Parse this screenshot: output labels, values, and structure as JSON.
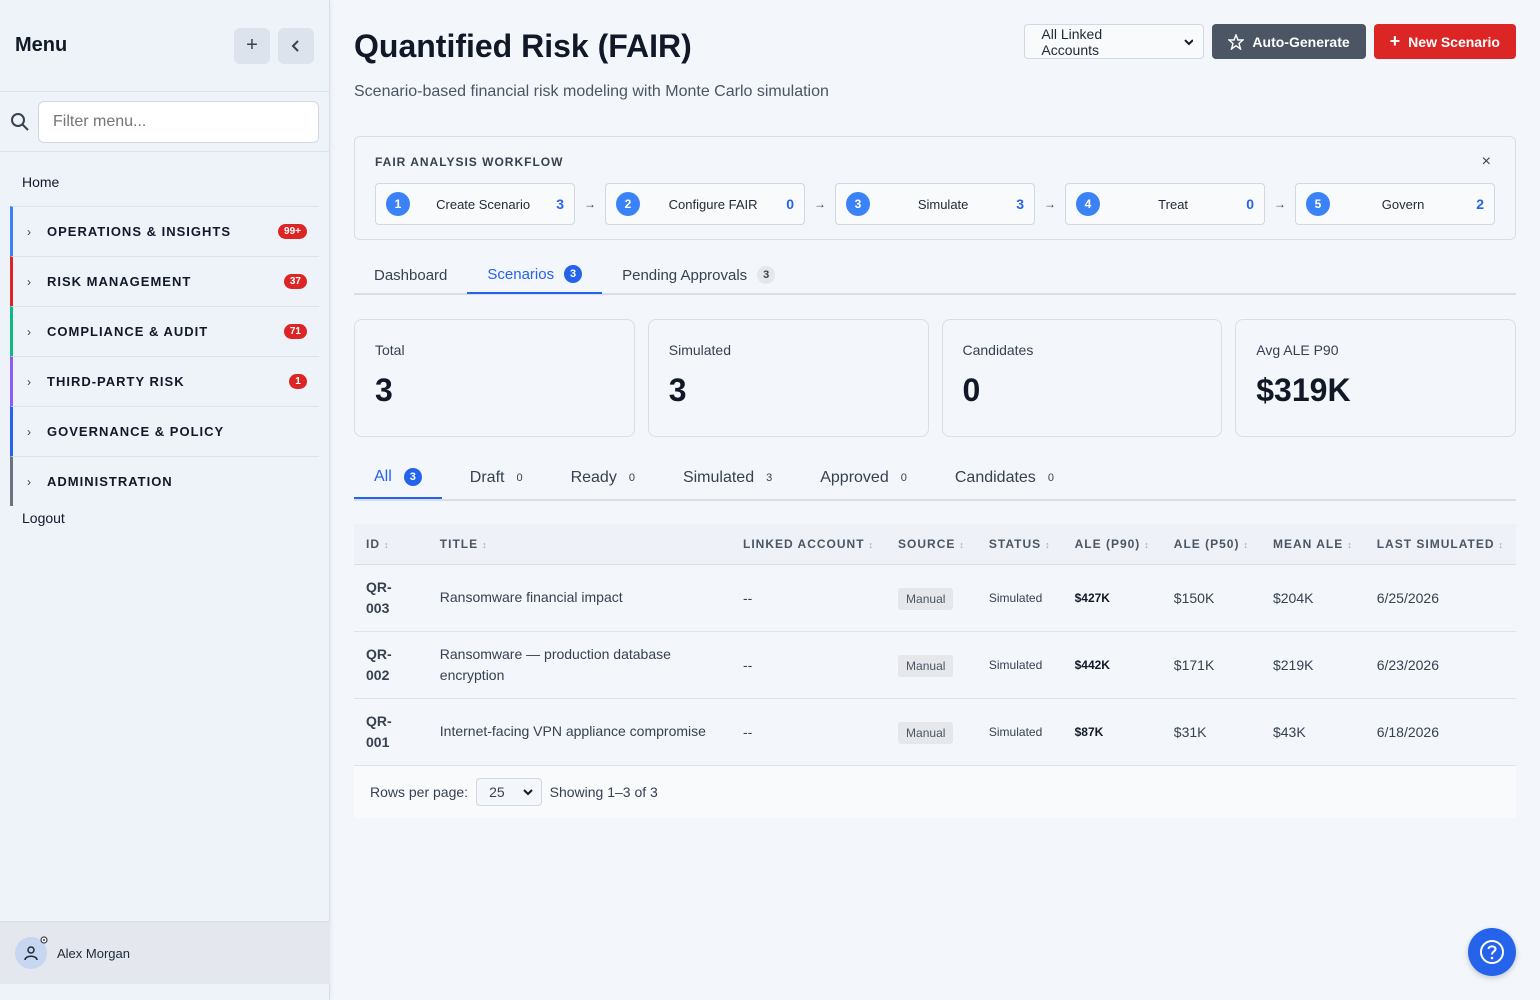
{
  "sidebar": {
    "title": "Menu",
    "filter_placeholder": "Filter menu...",
    "home": "Home",
    "items": [
      {
        "label": "OPERATIONS & INSIGHTS",
        "badge": "99+",
        "color": "#3b82f6"
      },
      {
        "label": "RISK MANAGEMENT",
        "badge": "37",
        "color": "#dc2626"
      },
      {
        "label": "COMPLIANCE & AUDIT",
        "badge": "71",
        "color": "#10b981"
      },
      {
        "label": "THIRD-PARTY RISK",
        "badge": "1",
        "color": "#8b5cf6"
      },
      {
        "label": "GOVERNANCE & POLICY",
        "badge": "",
        "color": "#2563eb"
      },
      {
        "label": "ADMINISTRATION",
        "badge": "",
        "color": "#6b7280"
      }
    ],
    "logout": "Logout",
    "user_name": "Alex Morgan"
  },
  "header": {
    "title": "Quantified Risk (FAIR)",
    "subtitle": "Scenario-based financial risk modeling with Monte Carlo simulation",
    "account_select": "All Linked Accounts",
    "auto_generate": "Auto-Generate",
    "new_scenario": "New Scenario"
  },
  "workflow": {
    "title": "FAIR ANALYSIS WORKFLOW",
    "close": "×",
    "steps": [
      {
        "num": "1",
        "label": "Create Scenario",
        "count": "3"
      },
      {
        "num": "2",
        "label": "Configure FAIR",
        "count": "0"
      },
      {
        "num": "3",
        "label": "Simulate",
        "count": "3"
      },
      {
        "num": "4",
        "label": "Treat",
        "count": "0"
      },
      {
        "num": "5",
        "label": "Govern",
        "count": "2"
      }
    ],
    "arrow": "→"
  },
  "main_tabs": [
    {
      "label": "Dashboard",
      "count": ""
    },
    {
      "label": "Scenarios",
      "count": "3"
    },
    {
      "label": "Pending Approvals",
      "count": "3"
    }
  ],
  "stats": [
    {
      "label": "Total",
      "value": "3"
    },
    {
      "label": "Simulated",
      "value": "3"
    },
    {
      "label": "Candidates",
      "value": "0"
    },
    {
      "label": "Avg ALE P90",
      "value": "$319K"
    }
  ],
  "filter_tabs": [
    {
      "label": "All",
      "count": "3"
    },
    {
      "label": "Draft",
      "count": "0"
    },
    {
      "label": "Ready",
      "count": "0"
    },
    {
      "label": "Simulated",
      "count": "3"
    },
    {
      "label": "Approved",
      "count": "0"
    },
    {
      "label": "Candidates",
      "count": "0"
    }
  ],
  "table": {
    "columns": [
      "ID",
      "TITLE",
      "LINKED ACCOUNT",
      "SOURCE",
      "STATUS",
      "ALE (P90)",
      "ALE (P50)",
      "MEAN ALE",
      "LAST SIMULATED"
    ],
    "rows": [
      {
        "id_a": "QR-",
        "id_b": "003",
        "title": "Ransomware financial impact",
        "account": "--",
        "source": "Manual",
        "status": "Simulated",
        "p90": "$427K",
        "p50": "$150K",
        "mean": "$204K",
        "last": "6/25/2026"
      },
      {
        "id_a": "QR-",
        "id_b": "002",
        "title": "Ransomware — production database encryption",
        "account": "--",
        "source": "Manual",
        "status": "Simulated",
        "p90": "$442K",
        "p50": "$171K",
        "mean": "$219K",
        "last": "6/23/2026"
      },
      {
        "id_a": "QR-",
        "id_b": "001",
        "title": "Internet-facing VPN appliance compromise",
        "account": "--",
        "source": "Manual",
        "status": "Simulated",
        "p90": "$87K",
        "p50": "$31K",
        "mean": "$43K",
        "last": "6/18/2026"
      }
    ]
  },
  "pager": {
    "rows_label": "Rows per page:",
    "rows_value": "25",
    "showing": "Showing 1–3 of 3"
  }
}
